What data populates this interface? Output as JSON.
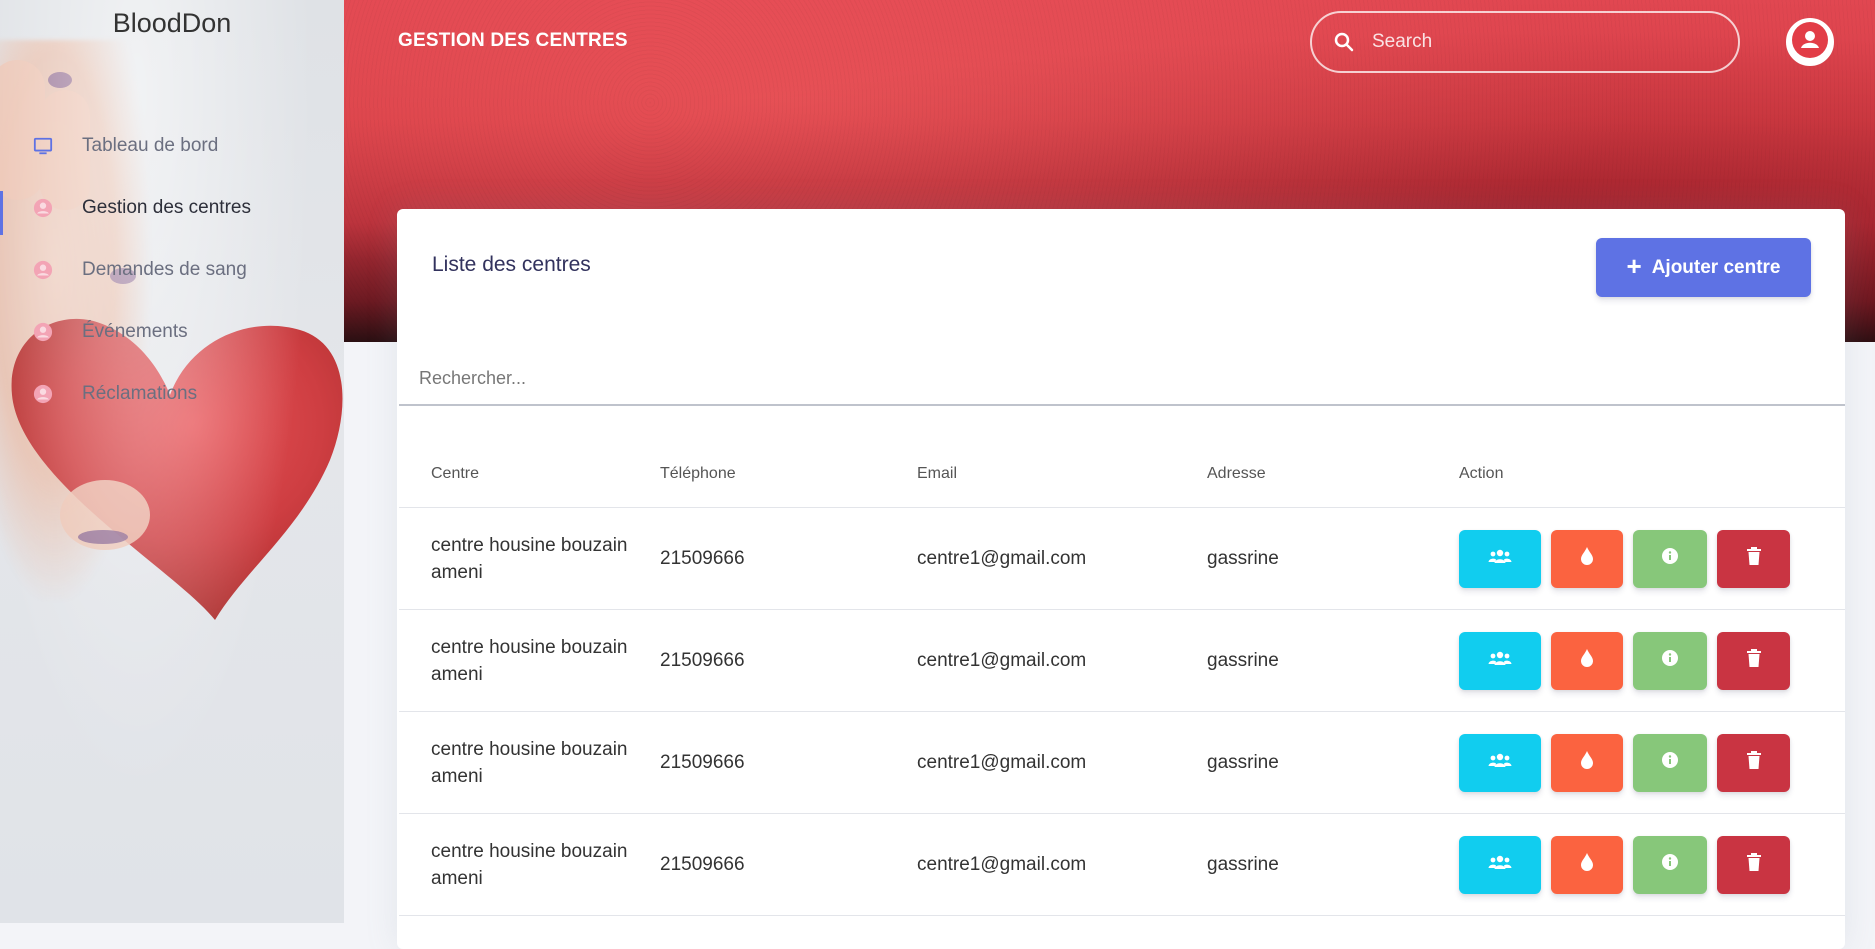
{
  "sidebar": {
    "brand": "BloodDon",
    "items": [
      {
        "label": "Tableau de bord",
        "icon": "tv-icon",
        "active": false
      },
      {
        "label": "Gestion des centres",
        "icon": "user-circle-icon",
        "active": true
      },
      {
        "label": "Demandes de sang",
        "icon": "user-circle-icon",
        "active": false
      },
      {
        "label": "Événements",
        "icon": "user-circle-icon",
        "active": false
      },
      {
        "label": "Réclamations",
        "icon": "user-circle-icon",
        "active": false
      }
    ]
  },
  "header": {
    "title": "GESTION DES CENTRES",
    "search_placeholder": "Search"
  },
  "card": {
    "title": "Liste des centres",
    "add_label": "Ajouter centre",
    "filter_placeholder": "Rechercher..."
  },
  "table": {
    "columns": [
      "Centre",
      "Téléphone",
      "Email",
      "Adresse",
      "Action"
    ],
    "rows": [
      {
        "centre": "centre housine bouzain ameni",
        "telephone": "21509666",
        "email": "centre1@gmail.com",
        "adresse": "gassrine"
      },
      {
        "centre": "centre housine bouzain ameni",
        "telephone": "21509666",
        "email": "centre1@gmail.com",
        "adresse": "gassrine"
      },
      {
        "centre": "centre housine bouzain ameni",
        "telephone": "21509666",
        "email": "centre1@gmail.com",
        "adresse": "gassrine"
      },
      {
        "centre": "centre housine bouzain ameni",
        "telephone": "21509666",
        "email": "centre1@gmail.com",
        "adresse": "gassrine"
      }
    ],
    "action_icons": [
      "users-icon",
      "blood-drop-icon",
      "info-icon",
      "trash-icon"
    ]
  },
  "colors": {
    "primary": "#5e72e4",
    "info": "#11cdef",
    "warning": "#fb6340",
    "success": "#87c77a",
    "danger": "#c93442"
  }
}
